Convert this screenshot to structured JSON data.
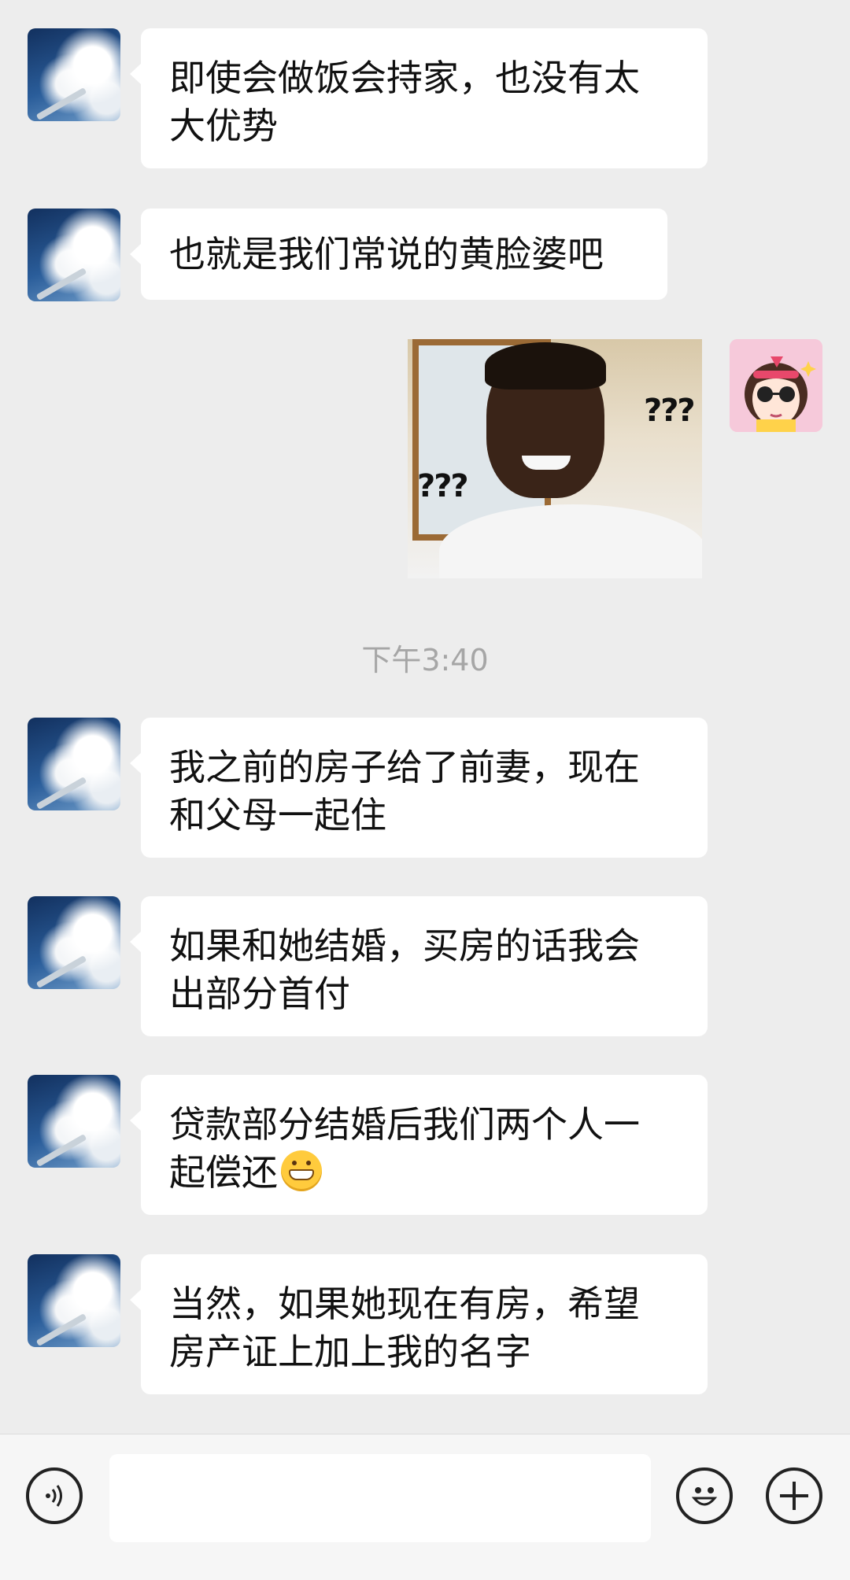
{
  "messages": [
    {
      "text": "即使会做饭会持家，也没有太大优势",
      "lines": [
        "即使会做饭会持家，也没有太",
        "大优势"
      ]
    },
    {
      "text": "也就是我们常说的黄脸婆吧"
    },
    {
      "lines": [
        "我之前的房子给了前妻，现在",
        "和父母一起住"
      ]
    },
    {
      "lines": [
        "如果和她结婚，买房的话我会",
        "出部分首付"
      ]
    },
    {
      "lines": [
        "贷款部分结婚后我们两个人一",
        "起偿还"
      ]
    },
    {
      "lines": [
        "当然，如果她现在有房，希望",
        "房产证上加上我的名字"
      ]
    }
  ],
  "sticker": {
    "left_label": "???",
    "right_label": "???"
  },
  "timestamp": "下午3:40",
  "input": {
    "value": "",
    "icons": [
      "voice-icon",
      "emoji-icon",
      "plus-icon"
    ]
  }
}
